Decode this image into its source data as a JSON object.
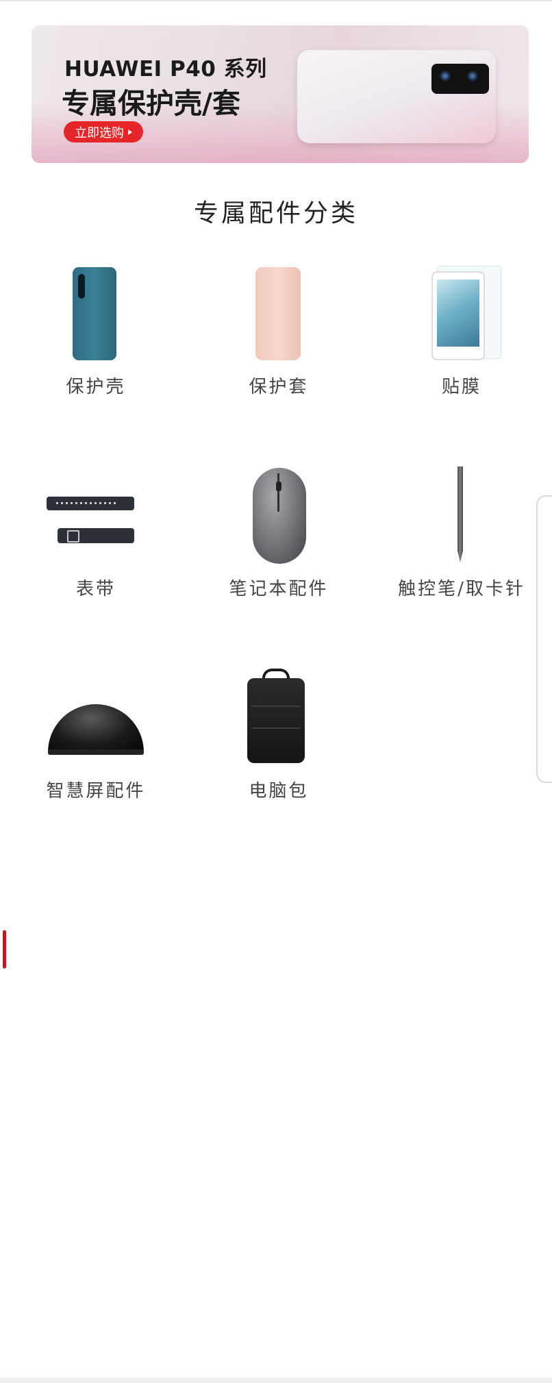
{
  "banner": {
    "brand": "HUAWEI P40 系列",
    "headline": "专属保护壳/套",
    "cta_label": "立即选购"
  },
  "section": {
    "title": "专属配件分类"
  },
  "categories": [
    {
      "label": "保护壳",
      "icon": "blue-phone-case-icon"
    },
    {
      "label": "保护套",
      "icon": "pink-flip-cover-icon"
    },
    {
      "label": "贴膜",
      "icon": "tablet-screen-film-icon"
    },
    {
      "label": "表带",
      "icon": "watch-strap-icon"
    },
    {
      "label": "笔记本配件",
      "icon": "mouse-icon"
    },
    {
      "label": "触控笔/取卡针",
      "icon": "stylus-icon"
    },
    {
      "label": "智慧屏配件",
      "icon": "dome-camera-icon"
    },
    {
      "label": "电脑包",
      "icon": "backpack-icon"
    }
  ],
  "colors": {
    "accent": "#e4262b",
    "scroll_marker": "#c0161d"
  }
}
